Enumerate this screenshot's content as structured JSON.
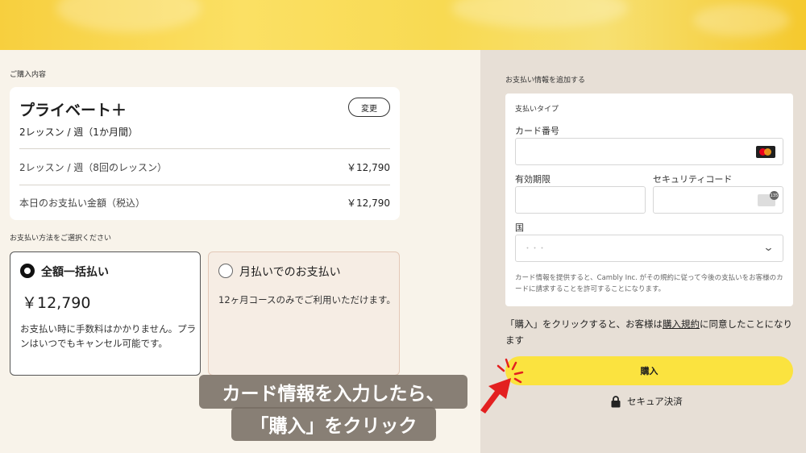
{
  "order_section": {
    "label": "ご購入内容",
    "plan_name": "プライベート＋",
    "plan_sub": "2レッスン / 週（1か月間）",
    "change_button": "変更",
    "rows": [
      {
        "label": "2レッスン / 週（8回のレッスン）",
        "price": "￥12,790"
      },
      {
        "label": "本日のお支払い金額（税込）",
        "price": "￥12,790"
      }
    ]
  },
  "payment_method": {
    "label": "お支払い方法をご選択ください",
    "options": [
      {
        "title": "全額一括払い",
        "price": "￥12,790",
        "desc": "お支払い時に手数料はかかりません。プランはいつでもキャンセル可能です。",
        "selected": true
      },
      {
        "title": "月払いでのお支払い",
        "desc": "12ヶ月コースのみでご利用いただけます。",
        "selected": false
      }
    ]
  },
  "payment_info": {
    "label": "お支払い情報を追加する",
    "type_label": "支払いタイプ",
    "card_number_label": "カード番号",
    "expiry_label": "有効期限",
    "cvc_label": "セキュリティコード",
    "country_label": "国",
    "country_value": "・・・",
    "disclaimer": "カード情報を提供すると、Cambly Inc. がその規約に従って今後の支払いをお客様のカードに請求することを許可することになります。",
    "cvc_badge": "135"
  },
  "agreement": {
    "before": "「購入」をクリックすると、お客様は",
    "link": "購入規約",
    "after": "に同意したことになります"
  },
  "buy_button": "購入",
  "secure_label": "セキュア決済",
  "caption": {
    "line1": "カード情報を入力したら、",
    "line2": "「購入」をクリック"
  },
  "icons": {
    "card_brand": "mastercard-icon",
    "cvc": "cvc-card-icon",
    "country_select": "chevron-down-icon",
    "secure": "lock-icon",
    "annotation": "red-arrow-icon"
  },
  "colors": {
    "accent_yellow": "#fbe33f",
    "annotation_red": "#e32020",
    "right_pane": "#e7dfd6",
    "left_pane": "#f8f3ea"
  }
}
